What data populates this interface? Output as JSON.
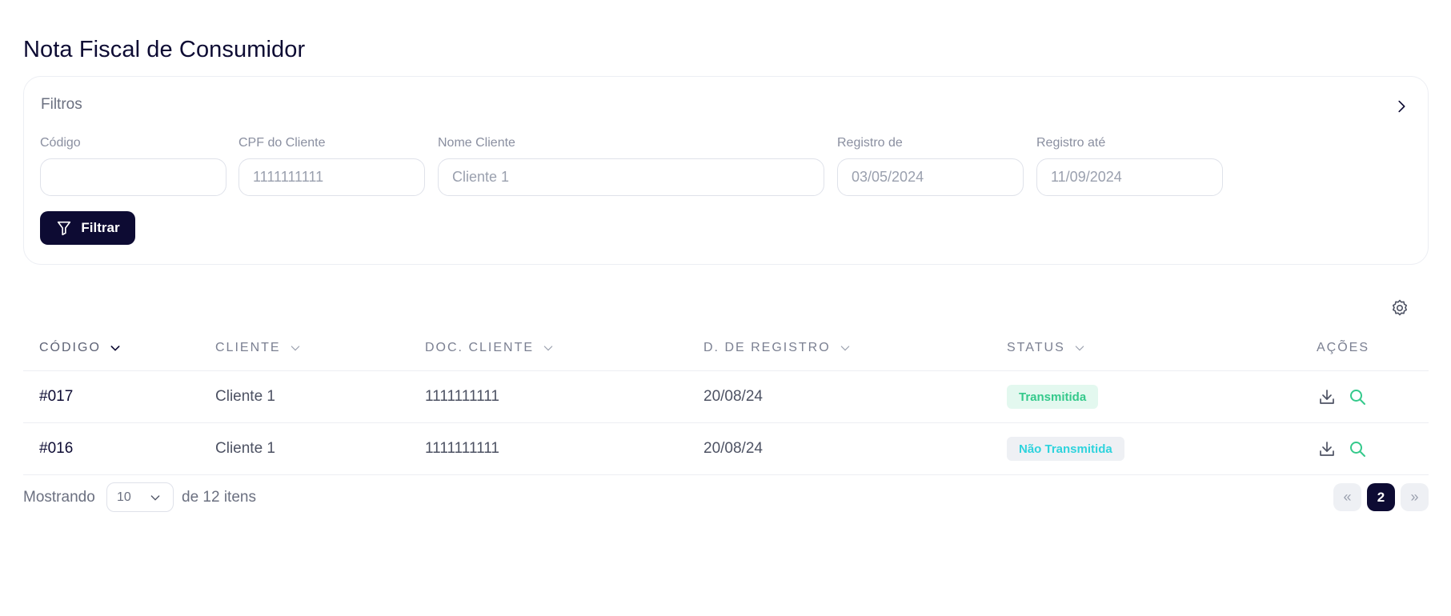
{
  "page": {
    "title": "Nota Fiscal de Consumidor"
  },
  "filters": {
    "title": "Filtros",
    "fields": [
      {
        "label": "Código",
        "value": "",
        "placeholder": ""
      },
      {
        "label": "CPF do Cliente",
        "value": "",
        "placeholder": "1111111111"
      },
      {
        "label": "Nome Cliente",
        "value": "",
        "placeholder": "Cliente 1"
      },
      {
        "label": "Registro de",
        "value": "",
        "placeholder": "03/05/2024"
      },
      {
        "label": "Registro até",
        "value": "",
        "placeholder": "11/09/2024"
      }
    ],
    "button_label": "Filtrar",
    "icons": {
      "toggle": "chevron-right-icon",
      "button": "funnel-icon"
    }
  },
  "table": {
    "columns": [
      "CÓDIGO",
      "CLIENTE",
      "DOC. CLIENTE",
      "D. DE REGISTRO",
      "STATUS",
      "AÇÕES"
    ],
    "sorted_column": "CÓDIGO",
    "rows": [
      {
        "code": "#017",
        "client": "Cliente 1",
        "doc": "1111111111",
        "date": "20/08/24",
        "status": "Transmitida",
        "status_kind": "ok"
      },
      {
        "code": "#016",
        "client": "Cliente 1",
        "doc": "1111111111",
        "date": "20/08/24",
        "status": "Não Transmitida",
        "status_kind": "pending"
      }
    ],
    "actions": [
      "download-icon",
      "search-icon"
    ],
    "settings_icon": "gear-icon"
  },
  "pagination": {
    "show_label": "Mostrando",
    "page_size": "10",
    "total_label": "de 12 itens",
    "prev": "«",
    "current_page": "2",
    "next": "»"
  },
  "colors": {
    "primary": "#0d0b33",
    "status_ok_text": "#34c98b",
    "status_ok_bg": "#e3f8ef",
    "status_pending_text": "#2ed3dd",
    "status_pending_bg": "#eef0f4",
    "search_action": "#34c98b"
  }
}
